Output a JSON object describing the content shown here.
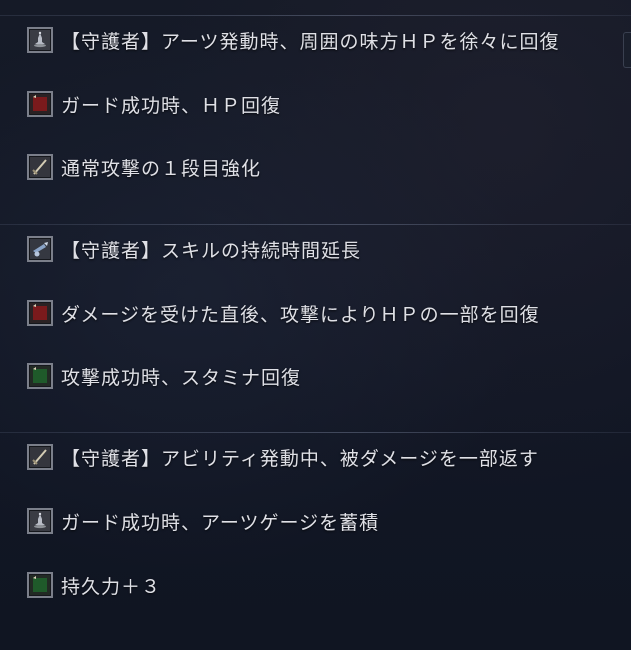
{
  "groups": [
    {
      "items": [
        {
          "icon": "bell-icon",
          "color": "#8e9298",
          "label": "【守護者】アーツ発動時、周囲の味方ＨＰを徐々に回復"
        },
        {
          "icon": "red-gem-icon",
          "color": "#7a1a1c",
          "label": "ガード成功時、ＨＰ回復"
        },
        {
          "icon": "sword-icon",
          "color": "#b0a890",
          "label": "通常攻撃の１段目強化"
        }
      ]
    },
    {
      "items": [
        {
          "icon": "cannon-icon",
          "color": "#8aa4c8",
          "label": "【守護者】スキルの持続時間延長"
        },
        {
          "icon": "red-gem-icon",
          "color": "#7a1a1c",
          "label": "ダメージを受けた直後、攻撃によりＨＰの一部を回復"
        },
        {
          "icon": "green-gem-icon",
          "color": "#1f5a2a",
          "label": "攻撃成功時、スタミナ回復"
        }
      ]
    },
    {
      "items": [
        {
          "icon": "sword-icon",
          "color": "#b0a890",
          "label": "【守護者】アビリティ発動中、被ダメージを一部返す"
        },
        {
          "icon": "bell-icon",
          "color": "#8e9298",
          "label": "ガード成功時、アーツゲージを蓄積"
        },
        {
          "icon": "green-gem-icon",
          "color": "#1f5a2a",
          "label": "持久力＋３"
        }
      ]
    }
  ]
}
